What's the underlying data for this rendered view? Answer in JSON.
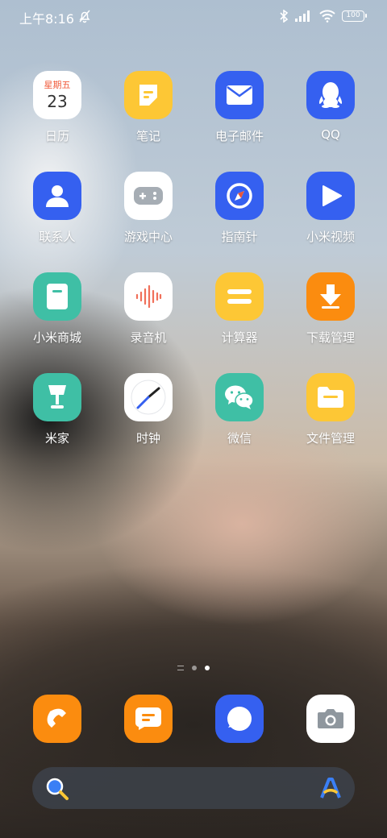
{
  "status": {
    "time": "上午8:16",
    "battery": "100"
  },
  "apps": [
    {
      "label": "日历",
      "weekday": "星期五",
      "day": "23"
    },
    {
      "label": "笔记"
    },
    {
      "label": "电子邮件"
    },
    {
      "label": "QQ"
    },
    {
      "label": "联系人"
    },
    {
      "label": "游戏中心"
    },
    {
      "label": "指南针"
    },
    {
      "label": "小米视频"
    },
    {
      "label": "小米商城"
    },
    {
      "label": "录音机"
    },
    {
      "label": "计算器"
    },
    {
      "label": "下载管理"
    },
    {
      "label": "米家"
    },
    {
      "label": "时钟"
    },
    {
      "label": "微信"
    },
    {
      "label": "文件管理"
    }
  ],
  "dock": [
    "phone-icon",
    "messages-icon",
    "browser-icon",
    "camera-icon"
  ],
  "page_indicator": {
    "pages": 2,
    "active": 2
  },
  "colors": {
    "blue": "#3560f0",
    "yellow": "#fdc735",
    "orange": "#fb8c0f",
    "teal": "#3fbfa5",
    "white": "#ffffff"
  }
}
